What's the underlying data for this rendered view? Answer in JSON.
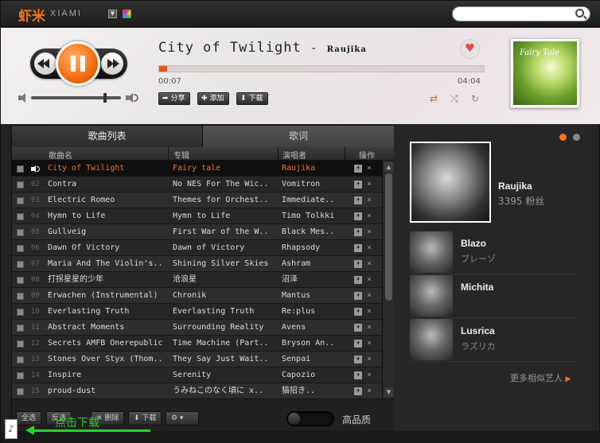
{
  "app": {
    "logo_cn": "虾米",
    "logo_en": "XIAMI"
  },
  "now_playing": {
    "title": "City of Twilight",
    "separator": "-",
    "artist": "Raujika",
    "elapsed": "00:07",
    "duration": "04:04",
    "progress_fraction": 0.024,
    "volume_fraction": 0.82,
    "cover_text": "Fairy Tale",
    "actions": {
      "share": "分享",
      "add": "添加",
      "download": "下载"
    }
  },
  "playlist": {
    "tabs": [
      "歌曲列表",
      "歌词"
    ],
    "headers": {
      "title": "歌曲名",
      "album": "专辑",
      "artist": "演唱者",
      "ops": "操作"
    },
    "rows": [
      {
        "num": "",
        "title": "City of Twilight",
        "album": "Fairy tale",
        "artist": "Raujika",
        "playing": true
      },
      {
        "num": "02",
        "title": "Contra",
        "album": "No NES For The Wic..",
        "artist": "Vomitron"
      },
      {
        "num": "03",
        "title": "Electric Romeo",
        "album": "Themes for Orchest..",
        "artist": "Immediate.."
      },
      {
        "num": "04",
        "title": "Hymn to Life",
        "album": "Hymn to Life",
        "artist": "Timo Tolkki"
      },
      {
        "num": "05",
        "title": "Gullveig",
        "album": "First War of the W..",
        "artist": "Black Mes.."
      },
      {
        "num": "06",
        "title": "Dawn Of Victory",
        "album": "Dawn of Victory",
        "artist": "Rhapsody"
      },
      {
        "num": "07",
        "title": "Maria And The Violin's..",
        "album": "Shining Silver Skies",
        "artist": "Ashram"
      },
      {
        "num": "08",
        "title": "打拐星星的少年",
        "album": "沧浪星",
        "artist": "沼泽"
      },
      {
        "num": "09",
        "title": "Erwachen (Instrumental)",
        "album": "Chronik",
        "artist": "Mantus"
      },
      {
        "num": "10",
        "title": "Everlasting Truth",
        "album": "Everlasting Truth",
        "artist": "Re:plus"
      },
      {
        "num": "11",
        "title": "Abstract Moments",
        "album": "Surrounding Reality",
        "artist": "Avens"
      },
      {
        "num": "12",
        "title": "Secrets AMFB Onerepublic",
        "album": "Time Machine (Part..",
        "artist": "Bryson An.."
      },
      {
        "num": "13",
        "title": "Stones Over Styx (Thom..",
        "album": "They Say Just Wait..",
        "artist": "Senpai"
      },
      {
        "num": "14",
        "title": "Inspire",
        "album": "Serenity",
        "artist": "Capozio"
      },
      {
        "num": "15",
        "title": "proud-dust",
        "album": "うみねこのなく頃に x..",
        "artist": "猫招き.."
      }
    ],
    "footer": {
      "select_all": "全选",
      "invert": "反选",
      "delete": "删除",
      "download": "下载",
      "hq_label": "高品质"
    }
  },
  "side": {
    "main_artist": {
      "name": "Raujika",
      "fans": "3395 粉丝"
    },
    "similar": [
      {
        "name": "Blazo",
        "sub": "ブレーゾ"
      },
      {
        "name": "Michita",
        "sub": ""
      },
      {
        "name": "Lusrica",
        "sub": "ラズリカ"
      }
    ],
    "more": "更多相似艺人"
  },
  "annotation": {
    "text": "点击下载"
  },
  "colors": {
    "accent": "#f3761f",
    "annotation": "#2bd12b"
  }
}
